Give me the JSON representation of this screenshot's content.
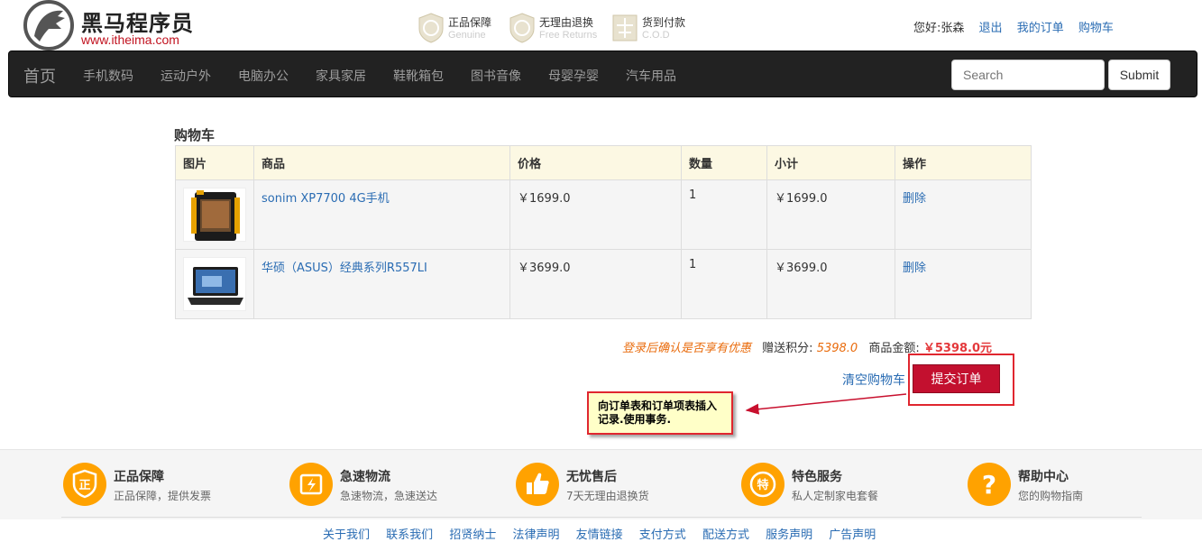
{
  "header": {
    "logo_cn": "黑马程序员",
    "logo_en": "www.itheima.com",
    "promises": [
      {
        "title": "正品保障",
        "sub": "Genuine"
      },
      {
        "title": "无理由退换",
        "sub": "Free Returns"
      },
      {
        "title": "货到付款",
        "sub": "C.O.D"
      }
    ],
    "user": {
      "greeting": "您好:张森",
      "logout": "退出",
      "orders": "我的订单",
      "cart": "购物车"
    }
  },
  "nav": {
    "home": "首页",
    "items": [
      "手机数码",
      "运动户外",
      "电脑办公",
      "家具家居",
      "鞋靴箱包",
      "图书音像",
      "母婴孕婴",
      "汽车用品"
    ],
    "search_placeholder": "Search",
    "submit_label": "Submit"
  },
  "cart": {
    "title": "购物车",
    "columns": [
      "图片",
      "商品",
      "价格",
      "数量",
      "小计",
      "操作"
    ],
    "rows": [
      {
        "name": "sonim XP7700 4G手机",
        "price": "￥1699.0",
        "qty": "1",
        "subtotal": "￥1699.0",
        "action": "删除"
      },
      {
        "name": "华硕（ASUS）经典系列R557LI",
        "price": "￥3699.0",
        "qty": "1",
        "subtotal": "￥3699.0",
        "action": "删除"
      }
    ],
    "summary": {
      "hint": "登录后确认是否享有优惠",
      "points_label": "赠送积分:",
      "points": "5398.0",
      "amount_label": "商品金额:",
      "amount": "￥5398.0元"
    },
    "clear_label": "清空购物车",
    "submit_label": "提交订单"
  },
  "annotation": {
    "text": "向订单表和订单项表插入记录.使用事务."
  },
  "footer": {
    "services": [
      {
        "icon": "正",
        "title": "正品保障",
        "sub": "正品保障，提供发票"
      },
      {
        "icon": "⚡",
        "title": "急速物流",
        "sub": "急速物流，急速送达"
      },
      {
        "icon": "👍",
        "title": "无忧售后",
        "sub": "7天无理由退换货"
      },
      {
        "icon": "特",
        "title": "特色服务",
        "sub": "私人定制家电套餐"
      },
      {
        "icon": "?",
        "title": "帮助中心",
        "sub": "您的购物指南"
      }
    ],
    "links": [
      "关于我们",
      "联系我们",
      "招贤纳士",
      "法律声明",
      "友情链接",
      "支付方式",
      "配送方式",
      "服务声明",
      "广告声明"
    ]
  },
  "colors": {
    "nav_bg": "#222222",
    "table_header_bg": "#fcf8e3",
    "link": "#2a6cb3",
    "submit_bg": "#c3102f",
    "service_icon": "#ffa200",
    "hint": "#e96b0c"
  }
}
